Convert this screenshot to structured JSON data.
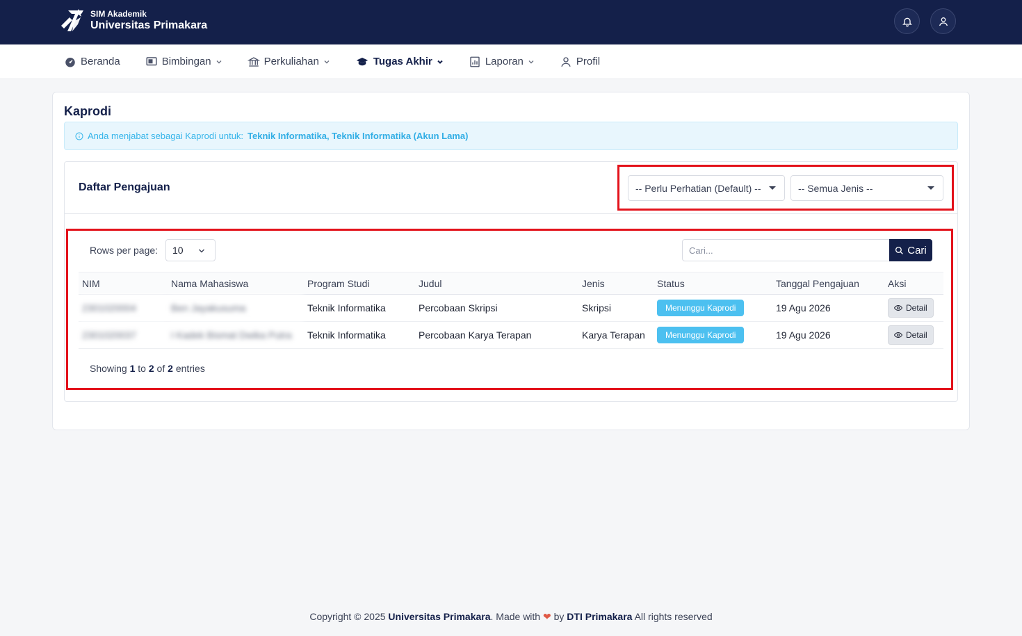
{
  "topbar": {
    "brand_sub": "SIM Akademik",
    "brand_title": "Universitas Primakara",
    "notification_icon": "bell-icon",
    "profile_icon": "user-icon"
  },
  "nav": {
    "items": [
      {
        "label": "Beranda",
        "icon": "dashboard-icon",
        "dropdown": false
      },
      {
        "label": "Bimbingan",
        "icon": "presentation-icon",
        "dropdown": true
      },
      {
        "label": "Perkuliahan",
        "icon": "bank-icon",
        "dropdown": true
      },
      {
        "label": "Tugas Akhir",
        "icon": "graduation-cap-icon",
        "dropdown": true,
        "active": true
      },
      {
        "label": "Laporan",
        "icon": "report-icon",
        "dropdown": true
      },
      {
        "label": "Profil",
        "icon": "person-icon",
        "dropdown": false
      }
    ]
  },
  "page": {
    "title": "Kaprodi",
    "alert_prefix": "Anda menjabat sebagai Kaprodi untuk:",
    "alert_programs": "Teknik Informatika, Teknik Informatika (Akun Lama)"
  },
  "list": {
    "title": "Daftar Pengajuan",
    "filter_status": "-- Perlu Perhatian (Default) --",
    "filter_type": "-- Semua Jenis --",
    "rows_per_page_label": "Rows per page:",
    "rows_per_page_value": "10",
    "search_placeholder": "Cari...",
    "search_button": "Cari",
    "columns": [
      "NIM",
      "Nama Mahasiswa",
      "Program Studi",
      "Judul",
      "Jenis",
      "Status",
      "Tanggal Pengajuan",
      "Aksi"
    ],
    "rows": [
      {
        "nim": "2301020004",
        "nama": "Ben Jayakusuma",
        "prodi": "Teknik Informatika",
        "judul": "Percobaan Skripsi",
        "jenis": "Skripsi",
        "status": "Menunggu Kaprodi",
        "tanggal": "19 Agu 2026",
        "aksi": "Detail"
      },
      {
        "nim": "2301020037",
        "nama": "I Kadek Bismat Dwika Putra",
        "prodi": "Teknik Informatika",
        "judul": "Percobaan Karya Terapan",
        "jenis": "Karya Terapan",
        "status": "Menunggu Kaprodi",
        "tanggal": "19 Agu 2026",
        "aksi": "Detail"
      }
    ],
    "showing": {
      "prefix": "Showing",
      "from": "1",
      "to_word": "to",
      "to": "2",
      "of_word": "of",
      "total": "2",
      "suffix": "entries"
    }
  },
  "footer": {
    "copyright": "Copyright © 2025",
    "org": "Universitas Primakara",
    "made_with": ". Made with",
    "by": "by",
    "team": "DTI Primakara",
    "rights": "All rights reserved"
  },
  "colors": {
    "navy": "#14204a",
    "info": "#36b5ea",
    "badge": "#4cc0f0",
    "highlight": "#e3121b"
  }
}
